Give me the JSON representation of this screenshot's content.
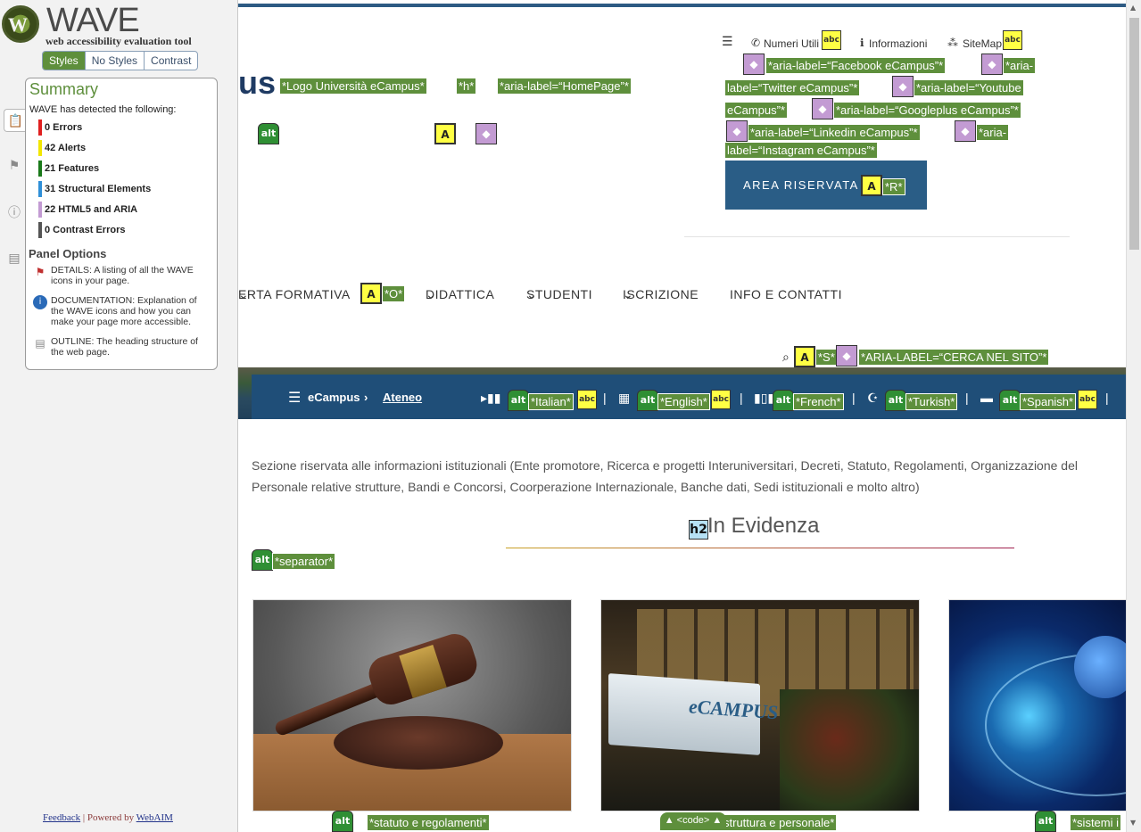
{
  "wave": {
    "logo_word": "WAVE",
    "logo_subtitle": "web accessibility evaluation tool",
    "style_tabs": [
      "Styles",
      "No Styles",
      "Contrast"
    ],
    "summary": {
      "title": "Summary",
      "detected": "WAVE has detected the following:",
      "counts": [
        {
          "label": "0 Errors",
          "color": "#e02020"
        },
        {
          "label": "42 Alerts",
          "color": "#f2e600"
        },
        {
          "label": "21 Features",
          "color": "#1a7a1a"
        },
        {
          "label": "31 Structural Elements",
          "color": "#2f8fd8"
        },
        {
          "label": "22 HTML5 and ARIA",
          "color": "#c39bd3"
        },
        {
          "label": "0 Contrast Errors",
          "color": "#555555"
        }
      ],
      "panel_options_title": "Panel Options",
      "options": [
        {
          "icon": "flag-icon",
          "text": "DETAILS: A listing of all the WAVE icons in your page."
        },
        {
          "icon": "info-icon",
          "text": "DOCUMENTATION: Explanation of the WAVE icons and how you can make your page more accessible."
        },
        {
          "icon": "document-icon",
          "text": "OUTLINE: The heading structure of the web page."
        }
      ]
    },
    "footer": {
      "feedback": "Feedback",
      "sep": " | Powered by ",
      "webaim": "WebAIM"
    }
  },
  "page": {
    "logo_fragment": "us",
    "labels": {
      "logo_univ": "*Logo Università eCampus*",
      "h": "*h*",
      "homepage": "*aria-label=“HomePage”*",
      "fb": "*aria-label=“Facebook eCampus”*",
      "tw1": "*aria-",
      "tw2": "label=“Twitter eCampus”*",
      "yt1": "*aria-label=“Youtube",
      "yt2": "eCampus”*",
      "gp": "*aria-label=“Googleplus eCampus”*",
      "li": "*aria-label=“Linkedin eCampus”*",
      "ig1": "*aria-",
      "ig2": "label=“Instagram eCampus”*",
      "r": "*R*",
      "o": "*O*",
      "s": "*S*",
      "cerca": "*ARIA-LABEL=“CERCA NEL SITO”*",
      "italian": "*Italian*",
      "english": "*English*",
      "french": "*French*",
      "turkish": "*Turkish*",
      "spanish": "*Spanish*",
      "separator": "*separator*",
      "statuto": "*statuto e regolamenti*",
      "struttura": "struttura e personale*",
      "sistemi": "*sistemi i"
    },
    "topnav": {
      "numeri": "Numeri Utili",
      "info": "Informazioni",
      "sitemap": "SiteMap"
    },
    "area_riservata": "AREA RISERVATA",
    "mainnav": [
      "ERTA FORMATIVA",
      "DIDATTICA",
      "STUDENTI",
      "ISCRIZIONE",
      "INFO E CONTATTI"
    ],
    "breadcrumb": {
      "home": "eCampus",
      "current": "Ateneo"
    },
    "intro": "Sezione riservata alle informazioni istituzionali (Ente promotore, Ricerca e progetti Interuniversitari, Decreti, Statuto, Regolamenti, Organizzazione del Personale relative strutture, Bandi e Concorsi, Coorperazione Internazionale, Banche dati, Sedi istituzionali e molto altro)",
    "section_title": "In Evidenza",
    "sign_text": "eCAMPUS",
    "code_tab": "▲ <code> ▲",
    "icon_text": {
      "alt": "alt",
      "a": "A",
      "abc": "abc",
      "h2": "h2"
    }
  }
}
